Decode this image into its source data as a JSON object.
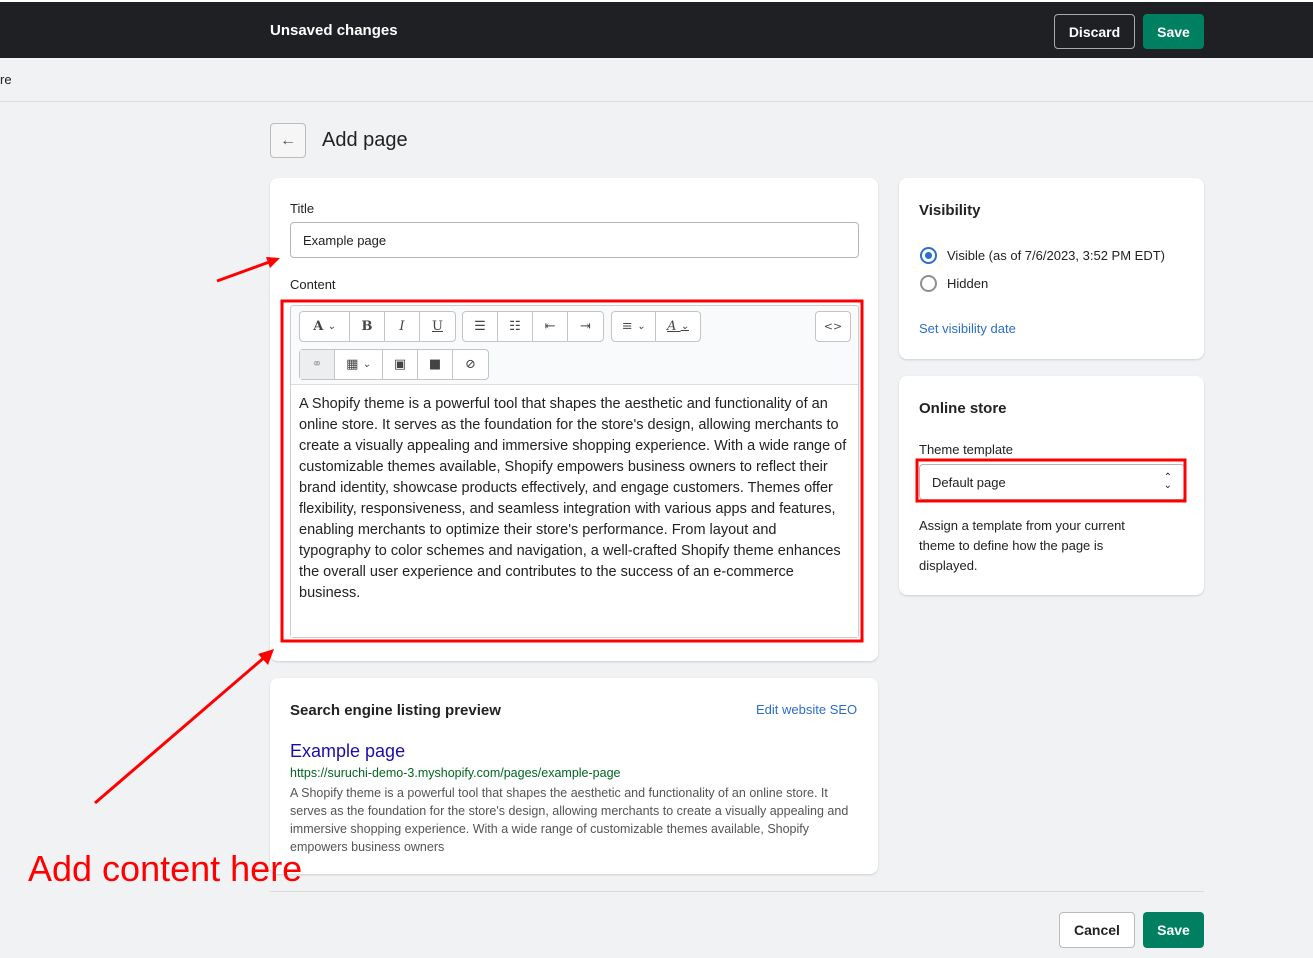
{
  "topbar": {
    "title": "Unsaved changes",
    "discard": "Discard",
    "save": "Save"
  },
  "breadcrumb": "re",
  "page": {
    "title": "Add page",
    "back_icon": "←"
  },
  "main": {
    "title_label": "Title",
    "title_value": "Example page",
    "content_label": "Content",
    "toolbar": {
      "font": "A",
      "bold": "B",
      "italic": "I",
      "underline": "U",
      "ul": "☰",
      "ol": "☷",
      "outdent": "⇤",
      "indent": "⇥",
      "align": "≡",
      "color": "A",
      "html": "<>",
      "link": "⚭",
      "table": "▦",
      "image": "▣",
      "video": "■",
      "clear": "⊘",
      "chev": "⌄"
    },
    "content_text": "A Shopify theme is a powerful tool that shapes the aesthetic and functionality of an online store. It serves as the foundation for the store's design, allowing merchants to create a visually appealing and immersive shopping experience. With a wide range of customizable themes available, Shopify empowers business owners to reflect their brand identity, showcase products effectively, and engage customers. Themes offer flexibility, responsiveness, and seamless integration with various apps and features, enabling merchants to optimize their store's performance. From layout and typography to color schemes and navigation, a well-crafted Shopify theme enhances the overall user experience and contributes to the success of an e-commerce business."
  },
  "seo": {
    "heading": "Search engine listing preview",
    "edit": "Edit website SEO",
    "title": "Example page",
    "url": "https://suruchi-demo-3.myshopify.com/pages/example-page",
    "description": "A Shopify theme is a powerful tool that shapes the aesthetic and functionality of an online store. It serves as the foundation for the store's design, allowing merchants to create a visually appealing and immersive shopping experience. With a wide range of customizable themes available, Shopify empowers business owners"
  },
  "visibility": {
    "heading": "Visibility",
    "visible": "Visible (as of 7/6/2023, 3:52 PM EDT)",
    "hidden": "Hidden",
    "set_date": "Set visibility date"
  },
  "online_store": {
    "heading": "Online store",
    "template_label": "Theme template",
    "template_value": "Default page",
    "help": "Assign a template from your current theme to define how the page is displayed."
  },
  "footer": {
    "cancel": "Cancel",
    "save": "Save"
  },
  "annotation": {
    "text": "Add content here",
    "color": "#ff0000"
  }
}
